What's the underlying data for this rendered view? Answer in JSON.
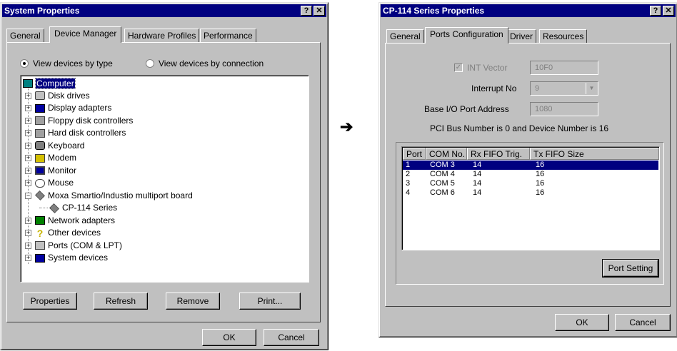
{
  "left_window": {
    "title": "System Properties",
    "title_buttons": [
      "?",
      "✕"
    ],
    "tabs": [
      "General",
      "Device Manager",
      "Hardware Profiles",
      "Performance"
    ],
    "active_tab": "Device Manager",
    "view_options": {
      "by_type": "View devices by type",
      "by_connection": "View devices by connection",
      "selected": "by_type"
    },
    "tree": [
      {
        "label": "Computer",
        "icon": "computer-icon",
        "selected": true
      },
      {
        "label": "Disk drives",
        "icon": "disk-drive-icon"
      },
      {
        "label": "Display adapters",
        "icon": "display-adapter-icon"
      },
      {
        "label": "Floppy disk controllers",
        "icon": "floppy-controller-icon"
      },
      {
        "label": "Hard disk controllers",
        "icon": "hard-disk-controller-icon"
      },
      {
        "label": "Keyboard",
        "icon": "keyboard-icon"
      },
      {
        "label": "Modem",
        "icon": "modem-icon"
      },
      {
        "label": "Monitor",
        "icon": "monitor-icon"
      },
      {
        "label": "Mouse",
        "icon": "mouse-icon"
      },
      {
        "label": "Moxa Smartio/Industio multiport board",
        "icon": "multiport-board-icon",
        "expanded": true
      },
      {
        "label": "CP-114 Series",
        "icon": "multiport-board-icon",
        "child": true
      },
      {
        "label": "Network adapters",
        "icon": "network-adapter-icon"
      },
      {
        "label": "Other devices",
        "icon": "question-icon"
      },
      {
        "label": "Ports (COM & LPT)",
        "icon": "port-icon"
      },
      {
        "label": "System devices",
        "icon": "system-device-icon"
      }
    ],
    "buttons": {
      "properties": "Properties",
      "refresh": "Refresh",
      "remove": "Remove",
      "print": "Print..."
    },
    "ok": "OK",
    "cancel": "Cancel"
  },
  "arrow": "➔",
  "right_window": {
    "title": "CP-114 Series Properties",
    "title_buttons": [
      "?",
      "✕"
    ],
    "tabs": [
      "General",
      "Ports Configuration",
      "Driver",
      "Resources"
    ],
    "active_tab": "Ports Configuration",
    "int_vector_label": "INT Vector",
    "int_vector_value": "10F0",
    "interrupt_label": "Interrupt No",
    "interrupt_value": "9",
    "base_io_label": "Base I/O Port Address",
    "base_io_value": "1080",
    "pci_info": "PCI Bus Number is 0 and Device Number is 16",
    "columns": [
      "Port",
      "COM No.",
      "Rx FIFO Trig.",
      "Tx FIFO Size"
    ],
    "rows": [
      {
        "port": "1",
        "com": "COM 3",
        "rx": "14",
        "tx": "16",
        "selected": true
      },
      {
        "port": "2",
        "com": "COM 4",
        "rx": "14",
        "tx": "16"
      },
      {
        "port": "3",
        "com": "COM 5",
        "rx": "14",
        "tx": "16"
      },
      {
        "port": "4",
        "com": "COM 6",
        "rx": "14",
        "tx": "16"
      }
    ],
    "port_setting": "Port Setting",
    "ok": "OK",
    "cancel": "Cancel"
  },
  "colors": {
    "title_bar": "#000080",
    "face": "#c0c0c0",
    "selection": "#000080"
  }
}
